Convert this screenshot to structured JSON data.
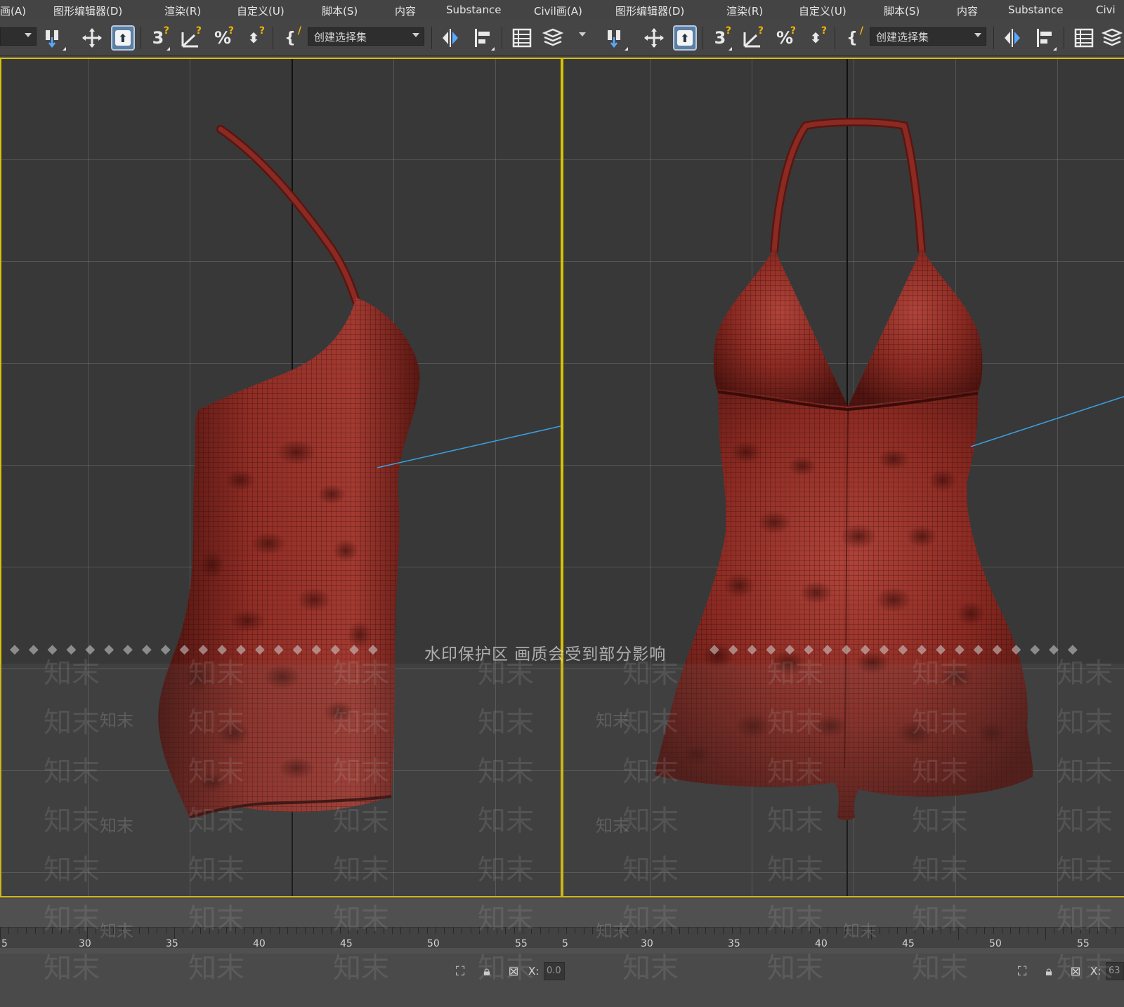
{
  "menu": {
    "pane1": [
      "画(A)",
      "图形编辑器(D)",
      "渲染(R)",
      "自定义(U)",
      "脚本(S)",
      "内容",
      "Substance",
      "Civil"
    ],
    "pane1_partial": "画(A)",
    "pane2": [
      "Civil画(A)",
      "图形编辑器(D)",
      "渲染(R)",
      "自定义(U)",
      "脚本(S)",
      "内容",
      "Substance",
      "Civi"
    ],
    "items": {
      "view_anim": "画(A)",
      "graph_editors": "图形编辑器(D)",
      "rendering": "渲染(R)",
      "customize": "自定义(U)",
      "scripting": "脚本(S)",
      "content": "内容",
      "substance": "Substance",
      "civil_view": "Civil画(A)",
      "civil_cut": "Civi"
    }
  },
  "toolbar": {
    "selection_set_placeholder": "创建选择集",
    "snap_3d_label": "3",
    "icons": [
      "select-link-icon",
      "move-icon",
      "select-object-icon",
      "snap-3d-icon",
      "angle-snap-icon",
      "percent-snap-icon",
      "spinner-snap-icon",
      "edit-named-sets-icon",
      "mirror-icon",
      "align-icon",
      "scene-explorer-icon",
      "layer-icon"
    ]
  },
  "watermark": {
    "notice": "水印保护区  画质会受到部分影响",
    "mark": "知末",
    "diamonds": "◆◆◆◆◆◆◆◆◆◆◆◆◆◆◆◆◆◆◆◆"
  },
  "ruler": {
    "labels": [
      "5",
      "30",
      "35",
      "40",
      "45",
      "50",
      "55"
    ]
  },
  "status": {
    "x_label": "X:",
    "x_value_left": "0.0",
    "x_value_right": "63"
  },
  "colors": {
    "viewport_border_active": "#d9c00a",
    "viewport_bg": "#383838",
    "garment": "#8a2a22",
    "light_ray": "#3aa0e0",
    "ui_bg": "#444444"
  }
}
